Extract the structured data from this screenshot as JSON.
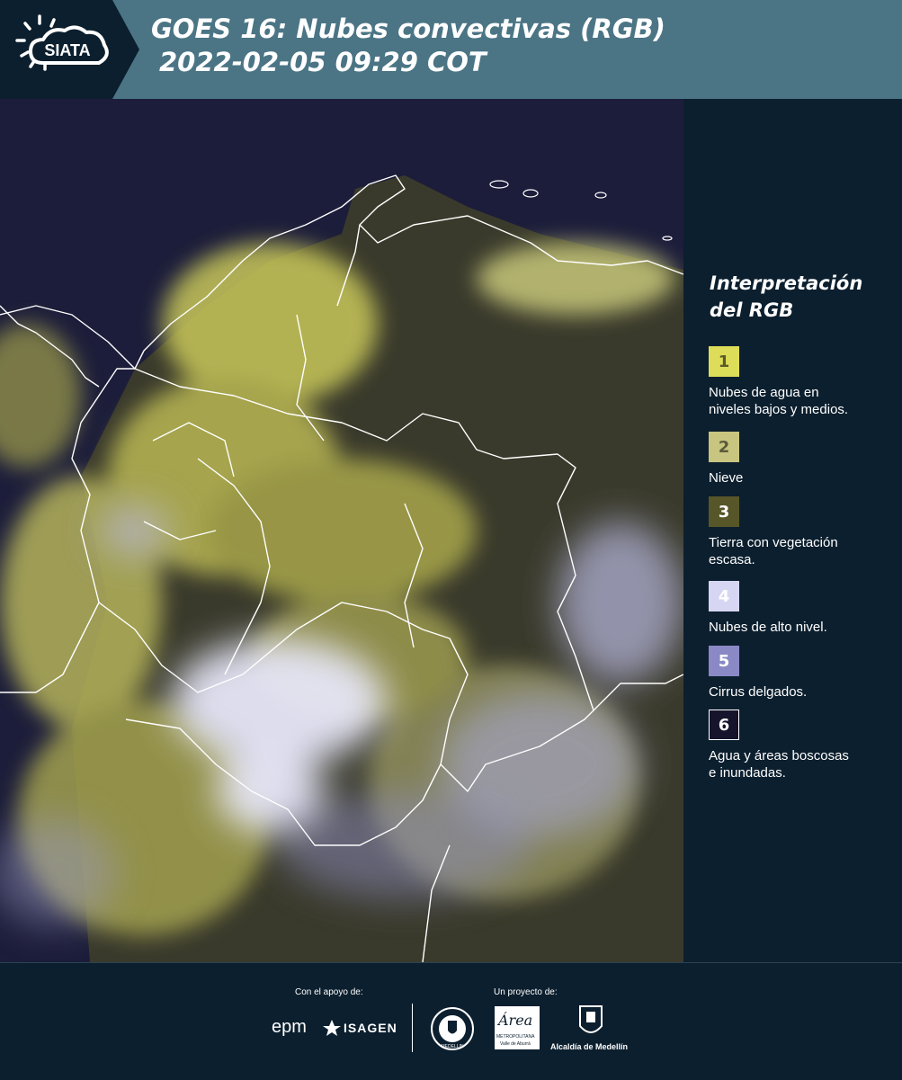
{
  "header": {
    "logo_text": "SIATA",
    "title_line1": "GOES 16: Nubes convectivas (RGB)",
    "title_line2": "2022-02-05 09:29 COT"
  },
  "legend": {
    "title_line1": "Interpretación",
    "title_line2": "del RGB",
    "items": [
      {
        "number": "1",
        "color": "#dedd5a",
        "text_color": "#5a5a2a",
        "line1": "Nubes de agua en",
        "line2": "niveles bajos y medios."
      },
      {
        "number": "2",
        "color": "#c8c580",
        "text_color": "#5b5a3b",
        "line1": "Nieve",
        "line2": ""
      },
      {
        "number": "3",
        "color": "#575629",
        "text_color": "#ffffff",
        "line1": "Tierra con vegetación",
        "line2": "escasa."
      },
      {
        "number": "4",
        "color": "#d6d6f3",
        "text_color": "#ffffff",
        "line1": "Nubes de alto nivel.",
        "line2": ""
      },
      {
        "number": "5",
        "color": "#8a89c6",
        "text_color": "#ffffff",
        "line1": "Cirrus delgados.",
        "line2": ""
      },
      {
        "number": "6",
        "color": "#15142c",
        "text_color": "#ffffff",
        "line1": "Agua y áreas boscosas",
        "line2": "e inundadas."
      }
    ]
  },
  "footer": {
    "support_label": "Con el apoyo de:",
    "project_label": "Un proyecto de:",
    "epm": "epm",
    "isagen": "ISAGEN",
    "medellin_seal": "MEDELLIN",
    "area_word": "Área",
    "area_sub1": "METROPOLITANA",
    "area_sub2": "Valle de Aburrá",
    "alcaldia": "Alcaldía de Medellín"
  },
  "colors": {
    "header_bg": "#4b7585",
    "panel_bg": "#0c1f2e",
    "map_water": "#1c1d3a",
    "low_clouds": "#d3d35a",
    "high_clouds": "#e2e2f7"
  }
}
